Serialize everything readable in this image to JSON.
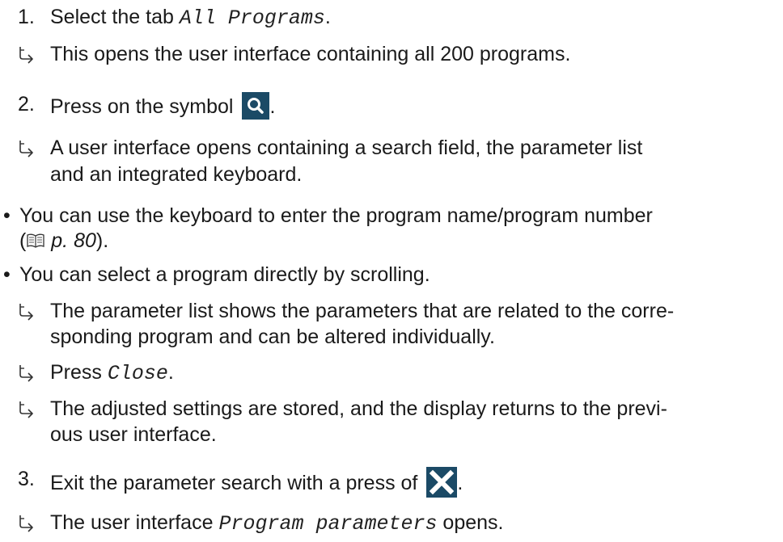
{
  "steps": [
    {
      "number": "1.",
      "text_before": "Select the tab ",
      "ui_term": "All Programs",
      "text_after": "."
    },
    {
      "number": "2.",
      "text_before": "Press on the symbol ",
      "icon": "search-icon",
      "text_after": "."
    },
    {
      "number": "3.",
      "text_before": " Exit the parameter search with a press of ",
      "icon": "close-icon",
      "text_after": "."
    }
  ],
  "results": {
    "r1": "This opens the user interface containing all 200 programs.",
    "r2_line1": "A user interface opens containing a search field, the parameter list",
    "r2_line2": "and an integrated keyboard.",
    "r3_line1": "The parameter list shows the parameters that are related to the corre-",
    "r3_line2": "sponding program and can be altered individually.",
    "r4_before": "Press ",
    "r4_term": "Close",
    "r4_after": ".",
    "r5_line1": "The adjusted settings are stored, and the display returns to the previ-",
    "r5_line2": "ous user interface.",
    "r6_before": "The user interface ",
    "r6_term": "Program parameters",
    "r6_after": " opens."
  },
  "bullets": {
    "b1_line1": "You can use the keyboard to enter the program name/program number",
    "b1_open": "(",
    "b1_ref": "p. 80",
    "b1_close": ").",
    "b2": "You can select a program directly by scrolling."
  },
  "colors": {
    "icon_bg": "#1b4a66",
    "text": "#1a1a1a"
  }
}
